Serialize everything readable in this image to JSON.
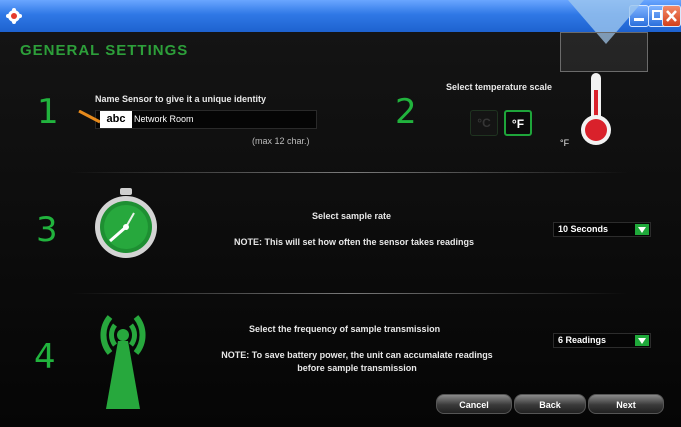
{
  "window": {
    "app_icon": "gear-app-icon",
    "minimize_icon": "minimize-icon",
    "maximize_icon": "maximize-icon",
    "close_icon": "close-icon"
  },
  "page_title": "GENERAL SETTINGS",
  "steps": {
    "name_sensor": {
      "number": "1",
      "instruction": "Name Sensor to give it a unique identity",
      "input_badge": "abc",
      "input_value": "Network Room",
      "hint": "(max 12 char.)",
      "icon": "pencil-icon"
    },
    "temperature": {
      "number": "2",
      "instruction": "Select temperature scale",
      "celsius_label": "°C",
      "fahrenheit_label": "°F",
      "selected": "°F",
      "thermometer_unit": "°F",
      "icon": "thermometer-icon"
    },
    "sample_rate": {
      "number": "3",
      "instruction": "Select sample rate",
      "note": "NOTE: This will set how often the sensor takes readings",
      "selected_value": "10 Seconds",
      "icon": "stopwatch-icon"
    },
    "transmission": {
      "number": "4",
      "instruction": "Select the frequency of sample transmission",
      "note_line1": "NOTE: To save battery power, the unit can accumalate readings",
      "note_line2": "before sample transmission",
      "selected_value": "6 Readings",
      "icon": "wireless-tower-icon"
    }
  },
  "buttons": {
    "cancel": "Cancel",
    "back": "Back",
    "next": "Next"
  },
  "colors": {
    "accent_green": "#21b33d",
    "titlebar_blue": "#2f78e6",
    "close_red": "#d2401b",
    "thermometer_red": "#d9212b"
  }
}
